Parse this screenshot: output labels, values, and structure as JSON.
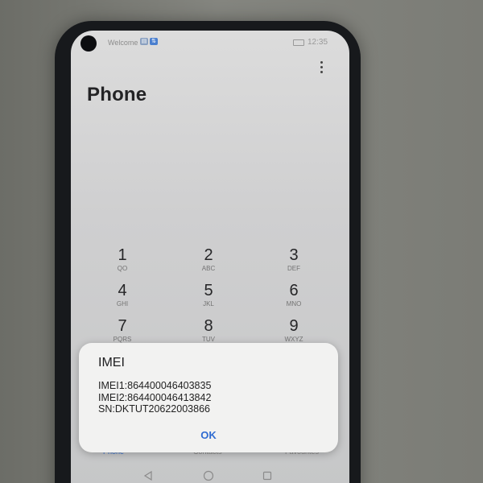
{
  "status_bar": {
    "carrier": "Welcome",
    "sim_icon": "sim-icon",
    "data_icon": "mobile-data-icon",
    "battery_icon": "battery-icon",
    "time": "12:35"
  },
  "app": {
    "title": "Phone",
    "menu_icon": "more-vertical-icon"
  },
  "keypad": [
    {
      "digit": "1",
      "letters": "QO"
    },
    {
      "digit": "2",
      "letters": "ABC"
    },
    {
      "digit": "3",
      "letters": "DEF"
    },
    {
      "digit": "4",
      "letters": "GHI"
    },
    {
      "digit": "5",
      "letters": "JKL"
    },
    {
      "digit": "6",
      "letters": "MNO"
    },
    {
      "digit": "7",
      "letters": "PQRS"
    },
    {
      "digit": "8",
      "letters": "TUV"
    },
    {
      "digit": "9",
      "letters": "WXYZ"
    }
  ],
  "bottom_tabs": [
    {
      "label": "Phone",
      "active": true
    },
    {
      "label": "Contacts",
      "active": false
    },
    {
      "label": "Favourites",
      "active": false
    }
  ],
  "nav_bar": {
    "back_icon": "back-triangle-icon",
    "home_icon": "home-circle-icon",
    "recent_icon": "recent-square-icon"
  },
  "dialog": {
    "title": "IMEI",
    "lines": [
      "IMEI1:864400046403835",
      "IMEI2:864400046413842",
      "SN:DKTUT20622003866"
    ],
    "ok_label": "OK"
  },
  "colors": {
    "accent": "#3b73d0",
    "dialog_background": "#f2f2f1",
    "phone_frame": "#17191c"
  }
}
